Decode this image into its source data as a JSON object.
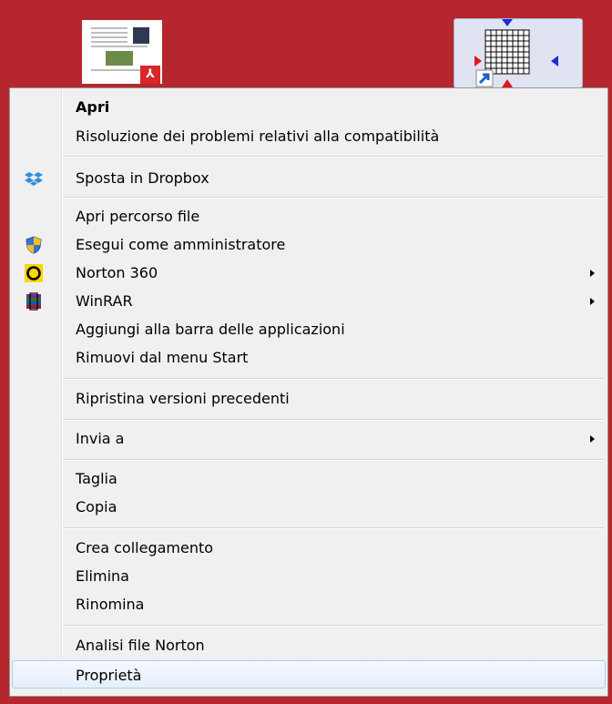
{
  "menu": {
    "items": [
      {
        "label": "Apri"
      },
      {
        "label": "Risoluzione dei problemi relativi alla compatibilità"
      },
      {
        "label": "Sposta in Dropbox"
      },
      {
        "label": "Apri percorso file"
      },
      {
        "label": "Esegui come amministratore"
      },
      {
        "label": "Norton 360"
      },
      {
        "label": "WinRAR"
      },
      {
        "label": "Aggiungi alla barra delle applicazioni"
      },
      {
        "label": "Rimuovi dal menu Start"
      },
      {
        "label": "Ripristina versioni precedenti"
      },
      {
        "label": "Invia a"
      },
      {
        "label": "Taglia"
      },
      {
        "label": "Copia"
      },
      {
        "label": "Crea collegamento"
      },
      {
        "label": "Elimina"
      },
      {
        "label": "Rinomina"
      },
      {
        "label": "Analisi file Norton"
      },
      {
        "label": "Proprietà"
      }
    ]
  },
  "icons": {
    "dropbox": "dropbox-icon",
    "admin": "uac-shield-icon",
    "norton": "norton-icon",
    "winrar": "winrar-icon",
    "pdf": "pdf-file-icon",
    "grid_shortcut": "grid-shortcut-icon"
  },
  "colors": {
    "desktop": "#b5262d",
    "menu_bg": "#f0f0f0",
    "hover_border": "#aeccf0"
  }
}
